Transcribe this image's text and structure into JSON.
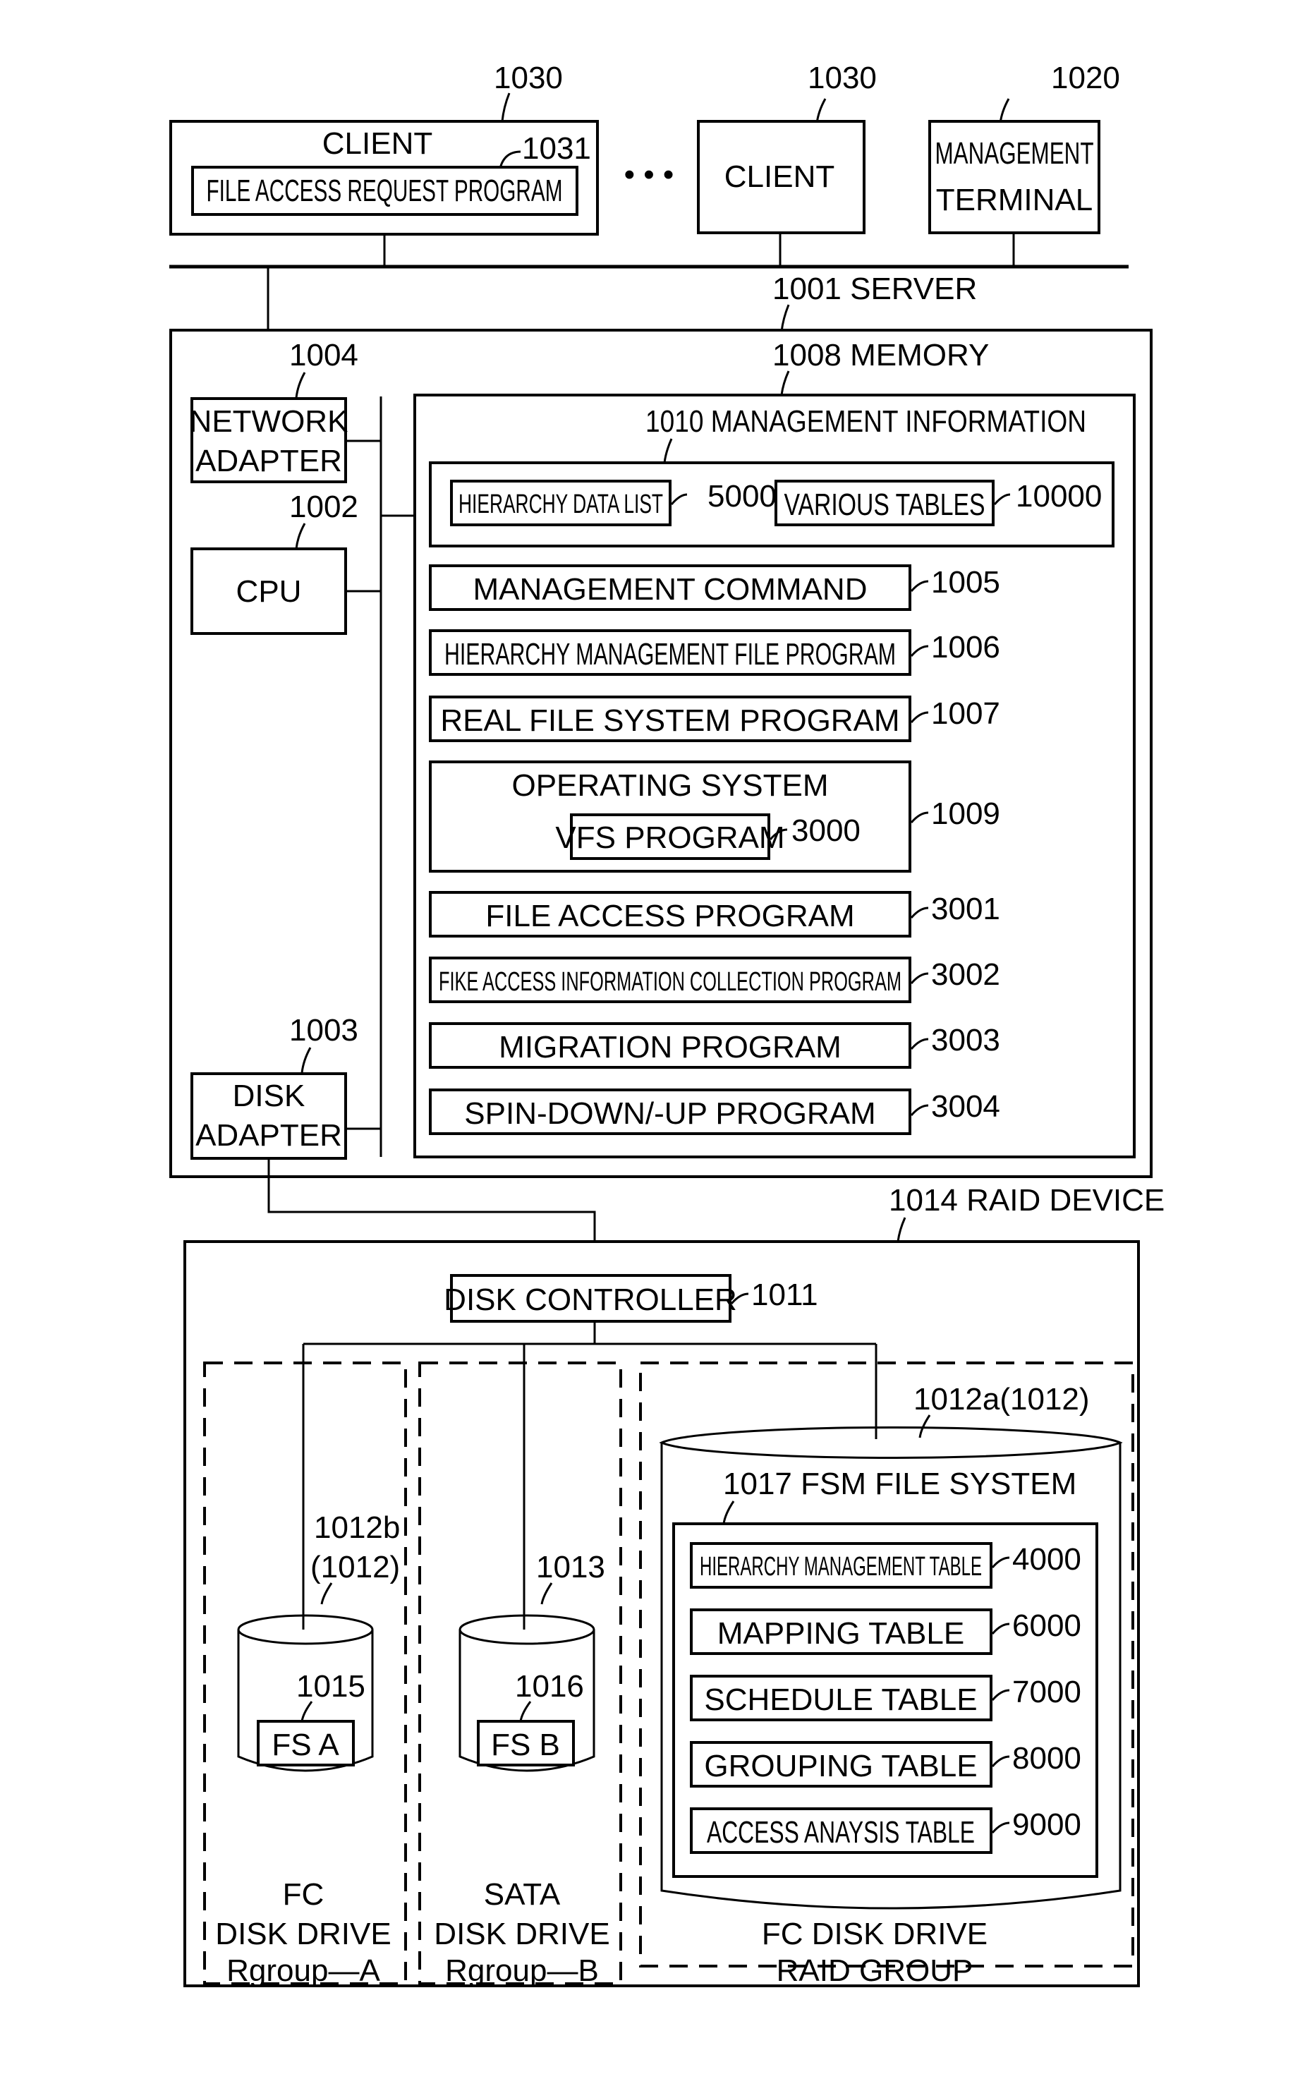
{
  "figure": {
    "clients": [
      {
        "ref": "1030",
        "label": "CLIENT",
        "program": {
          "ref": "1031",
          "label": "FILE ACCESS REQUEST PROGRAM"
        }
      },
      {
        "ref": "1030",
        "label": "CLIENT"
      }
    ],
    "ellipsis": "• • •",
    "management_terminal": {
      "ref": "1020",
      "line1": "MANAGEMENT",
      "line2": "TERMINAL"
    },
    "server": {
      "label": "1001 SERVER",
      "network_adapter": {
        "ref": "1004",
        "line1": "NETWORK",
        "line2": "ADAPTER"
      },
      "cpu": {
        "ref": "1002",
        "label": "CPU"
      },
      "disk_adapter": {
        "ref": "1003",
        "line1": "DISK",
        "line2": "ADAPTER"
      },
      "memory": {
        "label": "1008 MEMORY",
        "management_information": {
          "label": "1010 MANAGEMENT INFORMATION",
          "items": [
            {
              "label": "HIERARCHY DATA LIST",
              "ref": "5000"
            },
            {
              "label": "VARIOUS TABLES",
              "ref": "10000"
            }
          ]
        },
        "programs": [
          {
            "label": "MANAGEMENT COMMAND",
            "ref": "1005"
          },
          {
            "label": "HIERARCHY MANAGEMENT FILE PROGRAM",
            "ref": "1006"
          },
          {
            "label": "REAL FILE SYSTEM PROGRAM",
            "ref": "1007"
          },
          {
            "label": "OPERATING SYSTEM",
            "ref": "1009",
            "sub": {
              "label": "VFS PROGRAM",
              "ref": "3000"
            }
          },
          {
            "label": "FILE ACCESS PROGRAM",
            "ref": "3001"
          },
          {
            "label": "FIKE ACCESS INFORMATION COLLECTION PROGRAM",
            "ref": "3002"
          },
          {
            "label": "MIGRATION PROGRAM",
            "ref": "3003"
          },
          {
            "label": "SPIN-DOWN/-UP PROGRAM",
            "ref": "3004"
          }
        ]
      }
    },
    "raid_device": {
      "label": "1014 RAID DEVICE",
      "disk_controller": {
        "label": "DISK CONTROLLER",
        "ref": "1011"
      },
      "groups": [
        {
          "name": "Rgroup—A",
          "drive_type_line1": "FC",
          "drive_type_line2": "DISK DRIVE",
          "volume_ref_line1": "1012b",
          "volume_ref_line2": "(1012)",
          "fs": {
            "ref": "1015",
            "label": "FS A"
          }
        },
        {
          "name": "Rgroup—B",
          "drive_type_line1": "SATA",
          "drive_type_line2": "DISK DRIVE",
          "volume_ref_line1": "1013",
          "fs": {
            "ref": "1016",
            "label": "FS B"
          }
        },
        {
          "name": "RAID GROUP",
          "drive_type_line1": "FC DISK DRIVE",
          "volume_ref_line1": "1012a(1012)",
          "fsm": {
            "label": "1017 FSM FILE SYSTEM",
            "tables": [
              {
                "label": "HIERARCHY MANAGEMENT TABLE",
                "ref": "4000"
              },
              {
                "label": "MAPPING TABLE",
                "ref": "6000"
              },
              {
                "label": "SCHEDULE TABLE",
                "ref": "7000"
              },
              {
                "label": "GROUPING TABLE",
                "ref": "8000"
              },
              {
                "label": "ACCESS ANAYSIS TABLE",
                "ref": "9000"
              }
            ]
          }
        }
      ]
    }
  }
}
